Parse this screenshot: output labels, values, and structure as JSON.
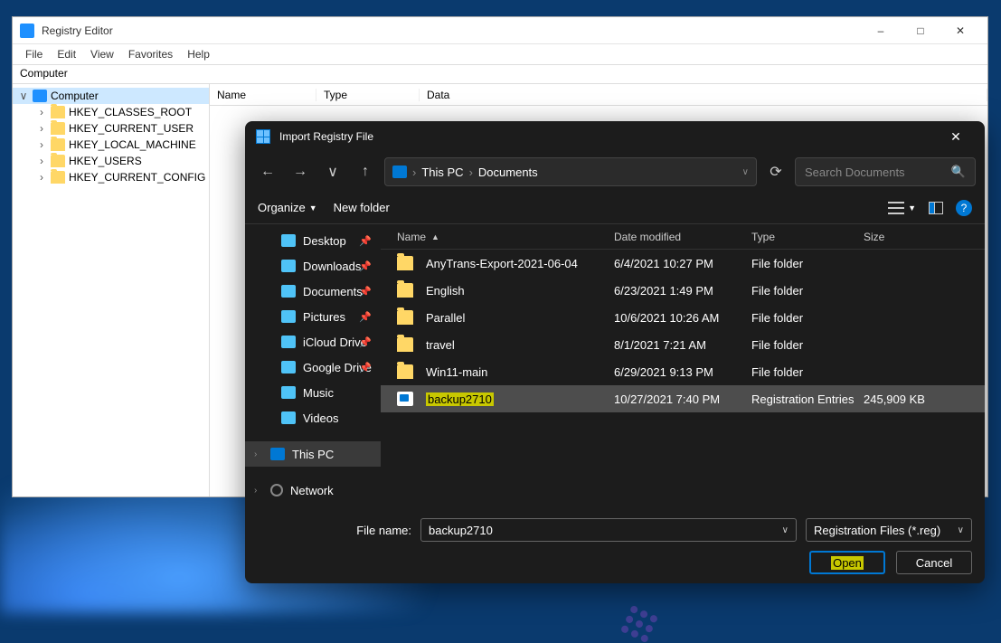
{
  "regedit": {
    "title": "Registry Editor",
    "menu": [
      "File",
      "Edit",
      "View",
      "Favorites",
      "Help"
    ],
    "path": "Computer",
    "tree": {
      "root": "Computer",
      "hives": [
        "HKEY_CLASSES_ROOT",
        "HKEY_CURRENT_USER",
        "HKEY_LOCAL_MACHINE",
        "HKEY_USERS",
        "HKEY_CURRENT_CONFIG"
      ]
    },
    "list_cols": {
      "name": "Name",
      "type": "Type",
      "data": "Data"
    }
  },
  "dialog": {
    "title": "Import Registry File",
    "path": {
      "root": "This PC",
      "folder": "Documents"
    },
    "search_placeholder": "Search Documents",
    "toolbar": {
      "organize": "Organize",
      "newfolder": "New folder"
    },
    "side": [
      {
        "label": "Desktop",
        "icon": "folder",
        "pin": true
      },
      {
        "label": "Downloads",
        "icon": "folder",
        "pin": true
      },
      {
        "label": "Documents",
        "icon": "folder",
        "pin": true
      },
      {
        "label": "Pictures",
        "icon": "folder",
        "pin": true
      },
      {
        "label": "iCloud Drive",
        "icon": "folder",
        "pin": true
      },
      {
        "label": "Google Drive",
        "icon": "folder",
        "pin": true
      },
      {
        "label": "Music",
        "icon": "folder",
        "pin": false
      },
      {
        "label": "Videos",
        "icon": "folder",
        "pin": false
      }
    ],
    "side_thispc": "This PC",
    "side_network": "Network",
    "file_cols": {
      "name": "Name",
      "date": "Date modified",
      "type": "Type",
      "size": "Size"
    },
    "files": [
      {
        "name": "AnyTrans-Export-2021-06-04",
        "date": "6/4/2021 10:27 PM",
        "type": "File folder",
        "size": "",
        "kind": "folder"
      },
      {
        "name": "English",
        "date": "6/23/2021 1:49 PM",
        "type": "File folder",
        "size": "",
        "kind": "folder"
      },
      {
        "name": "Parallel",
        "date": "10/6/2021 10:26 AM",
        "type": "File folder",
        "size": "",
        "kind": "folder"
      },
      {
        "name": "travel",
        "date": "8/1/2021 7:21 AM",
        "type": "File folder",
        "size": "",
        "kind": "folder"
      },
      {
        "name": "Win11-main",
        "date": "6/29/2021 9:13 PM",
        "type": "File folder",
        "size": "",
        "kind": "folder"
      },
      {
        "name": "backup2710",
        "date": "10/27/2021 7:40 PM",
        "type": "Registration Entries",
        "size": "245,909 KB",
        "kind": "reg",
        "selected": true,
        "highlight": true
      }
    ],
    "filename_label": "File name:",
    "filename_value": "backup2710",
    "filetype": "Registration Files (*.reg)",
    "open": "Open",
    "cancel": "Cancel"
  }
}
